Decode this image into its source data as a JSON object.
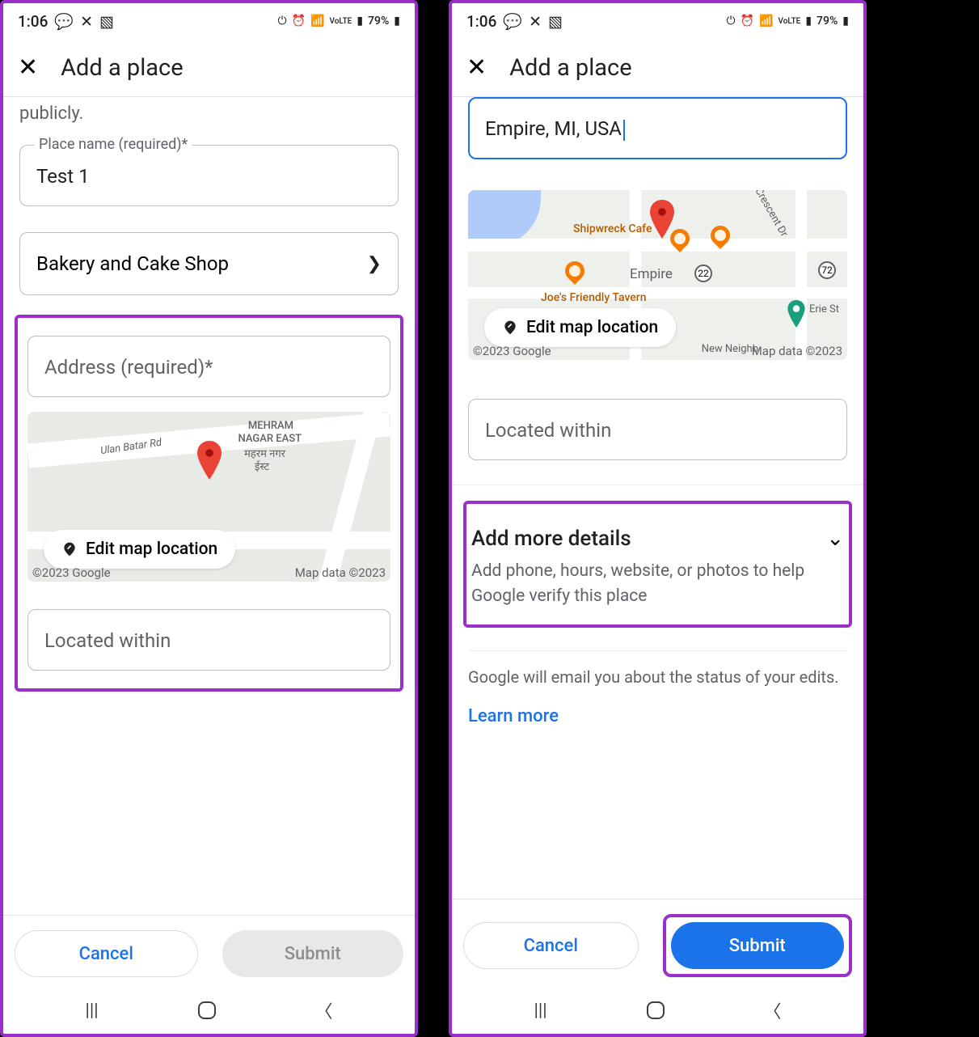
{
  "statusbar": {
    "time": "1:06",
    "battery": "79%",
    "net_label": "VoLTE"
  },
  "header": {
    "title": "Add a place"
  },
  "intro_fragment": "publicly.",
  "left": {
    "place_name_label": "Place name (required)*",
    "place_name_value": "Test 1",
    "category_value": "Bakery and Cake Shop",
    "address_placeholder": "Address (required)*",
    "located_placeholder": "Located within",
    "edit_map_label": "Edit map location",
    "map_copyright": "©2023 Google",
    "map_attrib": "Map data ©2023",
    "map_area_label_1": "MEHRAM",
    "map_area_label_2": "NAGAR EAST",
    "map_area_label_3": "महरम नगर",
    "map_area_label_4": "ईस्ट",
    "map_road_label": "Ulan Batar Rd"
  },
  "right": {
    "address_value": "Empire, MI, USA",
    "located_placeholder": "Located within",
    "edit_map_label": "Edit map location",
    "map_copyright": "©2023 Google",
    "map_attrib": "Map data ©2023",
    "map_city": "Empire",
    "map_route": "22",
    "map_poi1": "Shipwreck Cafe",
    "map_poi2": "Joe's Friendly Tavern",
    "map_street1": "Crescent Dr",
    "map_street2": "Erie St",
    "map_street3": "New Neighb",
    "route2": "72",
    "details_title": "Add more details",
    "details_sub": "Add phone, hours, website, or photos to help Google verify this place",
    "status_note": "Google will email you about the status of your edits.",
    "learn_more": "Learn more"
  },
  "footer": {
    "cancel": "Cancel",
    "submit": "Submit"
  }
}
